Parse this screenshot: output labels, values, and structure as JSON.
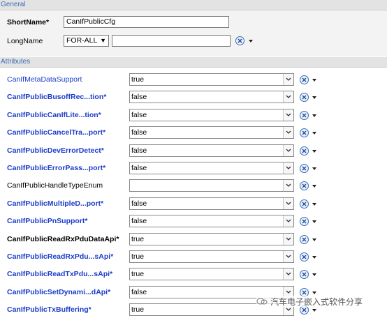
{
  "sections": {
    "general": "General",
    "attributes": "Attributes"
  },
  "general": {
    "shortname_label": "ShortName*",
    "shortname_value": "CanIfPublicCfg",
    "longname_label": "LongName",
    "language_value": "FOR-ALL",
    "longname_value": ""
  },
  "attributes": [
    {
      "label": "CanIfMetaDataSupport",
      "value": "true"
    },
    {
      "label": "CanIfPublicBusoffRec...tion*",
      "value": "false"
    },
    {
      "label": "CanIfPublicCanIfLite...tion*",
      "value": "false"
    },
    {
      "label": "CanIfPublicCancelTra...port*",
      "value": "false"
    },
    {
      "label": "CanIfPublicDevErrorDetect*",
      "value": "false"
    },
    {
      "label": "CanIfPublicErrorPass...port*",
      "value": "false"
    },
    {
      "label": "CanIfPublicHandleTypeEnum",
      "value": ""
    },
    {
      "label": "CanIfPublicMultipleD...port*",
      "value": "false"
    },
    {
      "label": "CanIfPublicPnSupport*",
      "value": "false"
    },
    {
      "label": "CanIfPublicReadRxPduDataApi*",
      "value": "true"
    },
    {
      "label": "CanIfPublicReadRxPdu...sApi*",
      "value": "true"
    },
    {
      "label": "CanIfPublicReadTxPdu...sApi*",
      "value": "true"
    },
    {
      "label": "CanIfPublicSetDynami...dApi*",
      "value": "false"
    },
    {
      "label": "CanIfPublicTxBuffering*",
      "value": "true"
    }
  ],
  "watermark": "汽车电子嵌入式软件分享",
  "colors": {
    "link": "#1a3cc8",
    "header_text": "#3b6db5",
    "header_bg": "#e3e3e3"
  },
  "icons": {
    "reset": "reset-default-icon",
    "menu": "dropdown-menu-arrow-icon"
  }
}
